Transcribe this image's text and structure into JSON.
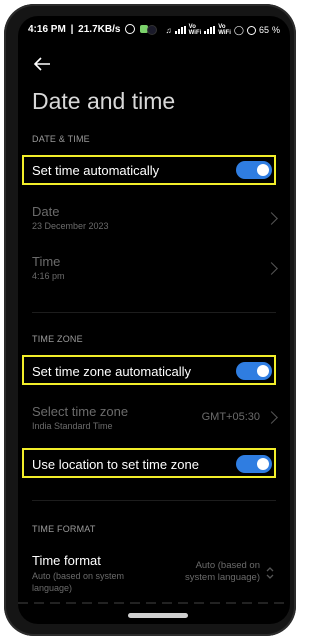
{
  "status": {
    "time": "4:16 PM",
    "speed": "21.7KB/s",
    "icons": [
      "data-saver-icon",
      "mute-icon",
      "signal-icon",
      "volte-icon",
      "wifi-icon",
      "battery-icon"
    ],
    "volte1": "Vo",
    "volte1b": "WiFi",
    "volte2": "Vo",
    "volte2b": "WiFi",
    "battery": "65"
  },
  "header": {
    "title": "Date and time"
  },
  "sections": {
    "datetime": "DATE & TIME",
    "timezone": "TIME ZONE",
    "timeformat": "TIME FORMAT"
  },
  "rows": {
    "set_time_auto": {
      "label": "Set time automatically",
      "on": true
    },
    "date": {
      "label": "Date",
      "value": "23 December 2023"
    },
    "time": {
      "label": "Time",
      "value": "4:16 pm"
    },
    "set_tz_auto": {
      "label": "Set time zone automatically",
      "on": true
    },
    "select_tz": {
      "label": "Select time zone",
      "sub": "India Standard Time",
      "value": "GMT+05:30"
    },
    "use_location": {
      "label": "Use location to set time zone",
      "on": true
    },
    "time_format": {
      "label": "Time format",
      "sub": "Auto (based on system language)",
      "value": "Auto (based on system language)"
    }
  },
  "colors": {
    "toggle_on": "#2f7de1",
    "highlight": "#f2ee2a"
  }
}
